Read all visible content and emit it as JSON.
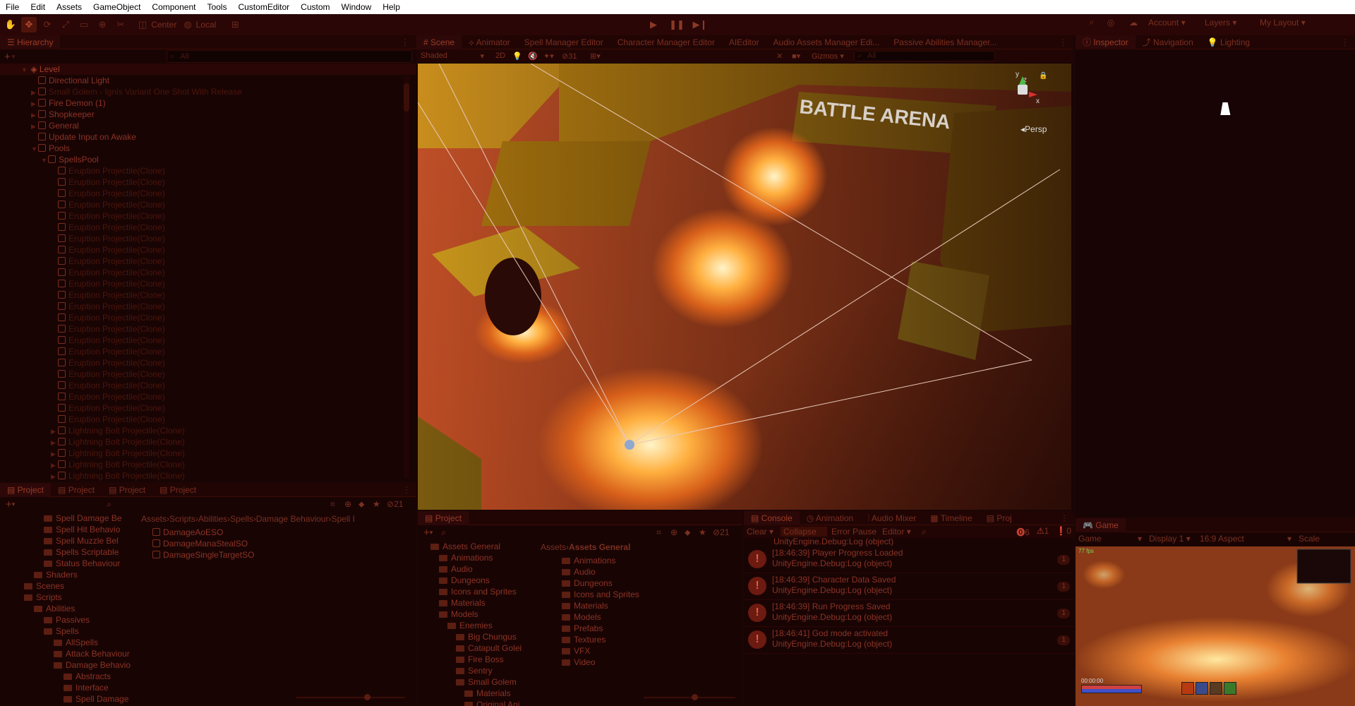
{
  "menu": [
    "File",
    "Edit",
    "Assets",
    "GameObject",
    "Component",
    "Tools",
    "CustomEditor",
    "Custom",
    "Window",
    "Help"
  ],
  "toolbar": {
    "pivot_label": "Center",
    "space_label": "Local",
    "account_label": "Account",
    "layers_label": "Layers",
    "layout_label": "My Layout"
  },
  "hierarchy": {
    "tab_label": "Hierarchy",
    "search_placeholder": "All",
    "scene_name": "Level",
    "items": [
      {
        "label": "Directional Light",
        "indent": 1,
        "ghost": false,
        "arrow": ""
      },
      {
        "label": "Small Golem - Ignis Variant One Shot With Release",
        "indent": 1,
        "ghost": true,
        "arrow": "▶"
      },
      {
        "label": "Fire Demon (1)",
        "indent": 1,
        "ghost": false,
        "arrow": "▶"
      },
      {
        "label": "Shopkeeper",
        "indent": 1,
        "ghost": false,
        "arrow": "▶"
      },
      {
        "label": "General",
        "indent": 1,
        "ghost": false,
        "arrow": "▶"
      },
      {
        "label": "Update Input on Awake",
        "indent": 1,
        "ghost": false,
        "arrow": ""
      },
      {
        "label": "Pools",
        "indent": 1,
        "ghost": false,
        "arrow": "▼"
      },
      {
        "label": "SpellsPool",
        "indent": 2,
        "ghost": false,
        "arrow": "▼"
      },
      {
        "label": "Eruption Projectile(Clone)",
        "indent": 3,
        "ghost": true,
        "arrow": ""
      },
      {
        "label": "Eruption Projectile(Clone)",
        "indent": 3,
        "ghost": true,
        "arrow": ""
      },
      {
        "label": "Eruption Projectile(Clone)",
        "indent": 3,
        "ghost": true,
        "arrow": ""
      },
      {
        "label": "Eruption Projectile(Clone)",
        "indent": 3,
        "ghost": true,
        "arrow": ""
      },
      {
        "label": "Eruption Projectile(Clone)",
        "indent": 3,
        "ghost": true,
        "arrow": ""
      },
      {
        "label": "Eruption Projectile(Clone)",
        "indent": 3,
        "ghost": true,
        "arrow": ""
      },
      {
        "label": "Eruption Projectile(Clone)",
        "indent": 3,
        "ghost": true,
        "arrow": ""
      },
      {
        "label": "Eruption Projectile(Clone)",
        "indent": 3,
        "ghost": true,
        "arrow": ""
      },
      {
        "label": "Eruption Projectile(Clone)",
        "indent": 3,
        "ghost": true,
        "arrow": ""
      },
      {
        "label": "Eruption Projectile(Clone)",
        "indent": 3,
        "ghost": true,
        "arrow": ""
      },
      {
        "label": "Eruption Projectile(Clone)",
        "indent": 3,
        "ghost": true,
        "arrow": ""
      },
      {
        "label": "Eruption Projectile(Clone)",
        "indent": 3,
        "ghost": true,
        "arrow": ""
      },
      {
        "label": "Eruption Projectile(Clone)",
        "indent": 3,
        "ghost": true,
        "arrow": ""
      },
      {
        "label": "Eruption Projectile(Clone)",
        "indent": 3,
        "ghost": true,
        "arrow": ""
      },
      {
        "label": "Eruption Projectile(Clone)",
        "indent": 3,
        "ghost": true,
        "arrow": ""
      },
      {
        "label": "Eruption Projectile(Clone)",
        "indent": 3,
        "ghost": true,
        "arrow": ""
      },
      {
        "label": "Eruption Projectile(Clone)",
        "indent": 3,
        "ghost": true,
        "arrow": ""
      },
      {
        "label": "Eruption Projectile(Clone)",
        "indent": 3,
        "ghost": true,
        "arrow": ""
      },
      {
        "label": "Eruption Projectile(Clone)",
        "indent": 3,
        "ghost": true,
        "arrow": ""
      },
      {
        "label": "Eruption Projectile(Clone)",
        "indent": 3,
        "ghost": true,
        "arrow": ""
      },
      {
        "label": "Eruption Projectile(Clone)",
        "indent": 3,
        "ghost": true,
        "arrow": ""
      },
      {
        "label": "Eruption Projectile(Clone)",
        "indent": 3,
        "ghost": true,
        "arrow": ""
      },
      {
        "label": "Eruption Projectile(Clone)",
        "indent": 3,
        "ghost": true,
        "arrow": ""
      },
      {
        "label": "Lightning Bolt Projectile(Clone)",
        "indent": 3,
        "ghost": true,
        "arrow": "▶"
      },
      {
        "label": "Lightning Bolt Projectile(Clone)",
        "indent": 3,
        "ghost": true,
        "arrow": "▶"
      },
      {
        "label": "Lightning Bolt Projectile(Clone)",
        "indent": 3,
        "ghost": true,
        "arrow": "▶"
      },
      {
        "label": "Lightning Bolt Projectile(Clone)",
        "indent": 3,
        "ghost": true,
        "arrow": "▶"
      },
      {
        "label": "Lightning Bolt Projectile(Clone)",
        "indent": 3,
        "ghost": true,
        "arrow": "▶"
      }
    ]
  },
  "scene": {
    "tabs": [
      "Scene",
      "Animator",
      "Spell Manager Editor",
      "Character Manager Editor",
      "AIEditor",
      "Audio Assets Manager Edi...",
      "Passive Abilities Manager..."
    ],
    "shading": "Shaded",
    "mode_2d": "2D",
    "gizmos": "Gizmos",
    "search_placeholder": "All",
    "hidden_count": "31",
    "persp_label": "Persp",
    "arena_sign": "BATTLE ARENA"
  },
  "inspector": {
    "tabs": [
      "Inspector",
      "Navigation",
      "Lighting"
    ]
  },
  "project_left": {
    "tabs": [
      "Project",
      "Project",
      "Project",
      "Project"
    ],
    "hidden_count": "21",
    "breadcrumb": [
      "Assets",
      "Scripts",
      "Abilities",
      "Spells",
      "Damage Behaviour",
      "Spell I"
    ],
    "tree": [
      {
        "label": "Spell Damage Be",
        "indent": 3
      },
      {
        "label": "Spell Hit Behavio",
        "indent": 3
      },
      {
        "label": "Spell Muzzle Bel",
        "indent": 3
      },
      {
        "label": "Spells Scriptable",
        "indent": 3
      },
      {
        "label": "Status Behaviour",
        "indent": 3
      },
      {
        "label": "Shaders",
        "indent": 2
      },
      {
        "label": "Scenes",
        "indent": 1
      },
      {
        "label": "Scripts",
        "indent": 1
      },
      {
        "label": "Abilities",
        "indent": 2
      },
      {
        "label": "Passives",
        "indent": 3
      },
      {
        "label": "Spells",
        "indent": 3
      },
      {
        "label": "AllSpells",
        "indent": 4
      },
      {
        "label": "Attack Behaviour",
        "indent": 4
      },
      {
        "label": "Damage Behavio",
        "indent": 4
      },
      {
        "label": "Abstracts",
        "indent": 5
      },
      {
        "label": "Interface",
        "indent": 5
      },
      {
        "label": "Spell Damage",
        "indent": 5
      }
    ],
    "files": [
      "DamageAoESO",
      "DamageManaStealSO",
      "DamageSingleTargetSO"
    ]
  },
  "project_mid": {
    "tab_label": "Project",
    "hidden_count": "21",
    "breadcrumb": [
      "Assets",
      "Assets General"
    ],
    "tree": [
      {
        "label": "Assets General",
        "indent": 0
      },
      {
        "label": "Animations",
        "indent": 1
      },
      {
        "label": "Audio",
        "indent": 1
      },
      {
        "label": "Dungeons",
        "indent": 1
      },
      {
        "label": "Icons and Sprites",
        "indent": 1
      },
      {
        "label": "Materials",
        "indent": 1
      },
      {
        "label": "Models",
        "indent": 1
      },
      {
        "label": "Enemies",
        "indent": 2
      },
      {
        "label": "Big Chungus",
        "indent": 3
      },
      {
        "label": "Catapult Golei",
        "indent": 3
      },
      {
        "label": "Fire Boss",
        "indent": 3
      },
      {
        "label": "Sentry",
        "indent": 3
      },
      {
        "label": "Small Golem",
        "indent": 3
      },
      {
        "label": "Materials",
        "indent": 4
      },
      {
        "label": "Original Ani",
        "indent": 4
      }
    ],
    "folders": [
      "Animations",
      "Audio",
      "Dungeons",
      "Icons and Sprites",
      "Materials",
      "Models",
      "Prefabs",
      "Textures",
      "VFX",
      "Video"
    ]
  },
  "console": {
    "tabs": [
      "Console",
      "Animation",
      "Audio Mixer",
      "Timeline",
      "Proj"
    ],
    "clear": "Clear",
    "collapse": "Collapse",
    "error_pause": "Error Pause",
    "editor": "Editor",
    "err_count": "6",
    "warn_count": "1",
    "info_count": "0",
    "partial_entry": "UnityEngine.Debug:Log (object)",
    "entries": [
      {
        "line1": "[18:46:39] Player Progress Loaded",
        "line2": "UnityEngine.Debug:Log (object)",
        "count": "1"
      },
      {
        "line1": "[18:46:39] Character Data Saved",
        "line2": "UnityEngine.Debug:Log (object)",
        "count": "1"
      },
      {
        "line1": "[18:46:39] Run Progress Saved",
        "line2": "UnityEngine.Debug:Log (object)",
        "count": "1"
      },
      {
        "line1": "[18:46:41] God mode activated",
        "line2": "UnityEngine.Debug:Log (object)",
        "count": "1"
      }
    ]
  },
  "game": {
    "tab_label": "Game",
    "mode": "Game",
    "display": "Display 1",
    "aspect": "16:9 Aspect",
    "scale": "Scale",
    "fps": "77 fps",
    "timer": "00:00:00"
  }
}
